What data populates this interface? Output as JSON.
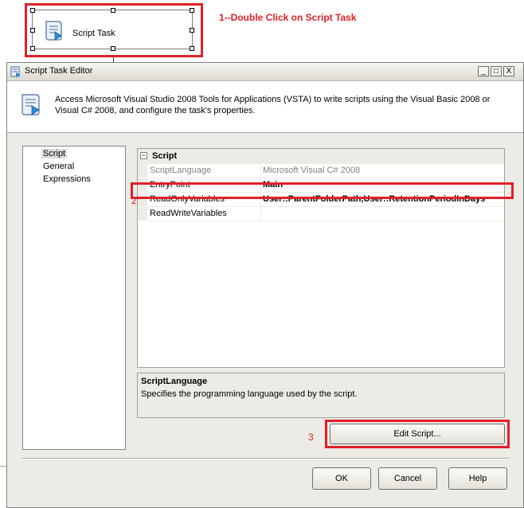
{
  "designer": {
    "task_label": "Script Task",
    "step1_label": "1--Double Click on Script Task"
  },
  "window": {
    "title": "Script Task Editor",
    "minimize": "_",
    "maximize": "□",
    "close": "X"
  },
  "header": {
    "description": "Access Microsoft Visual Studio 2008 Tools for Applications (VSTA) to write scripts using the Visual Basic 2008 or Visual C# 2008, and configure the task's properties."
  },
  "nav": {
    "items": [
      {
        "label": "Script",
        "selected": true
      },
      {
        "label": "General",
        "selected": false
      },
      {
        "label": "Expressions",
        "selected": false
      }
    ]
  },
  "properties": {
    "category": "Script",
    "category_toggle": "−",
    "rows": [
      {
        "name": "ScriptLanguage",
        "value": "Microsoft Visual C# 2008"
      },
      {
        "name": "EntryPoint",
        "value": "Main"
      },
      {
        "name": "ReadOnlyVariables",
        "value": "User::ParentFolderPath,User::RetentionPeriodInDays"
      },
      {
        "name": "ReadWriteVariables",
        "value": ""
      }
    ]
  },
  "annotations": {
    "step2": "2",
    "step3": "3"
  },
  "description_panel": {
    "title": "ScriptLanguage",
    "text": "Specifies the programming language used by the script."
  },
  "buttons": {
    "edit_script": "Edit Script...",
    "ok": "OK",
    "cancel": "Cancel",
    "help": "Help"
  },
  "colors": {
    "annotation_red": "#e0202a",
    "dialog_bg": "#ecebe5"
  }
}
